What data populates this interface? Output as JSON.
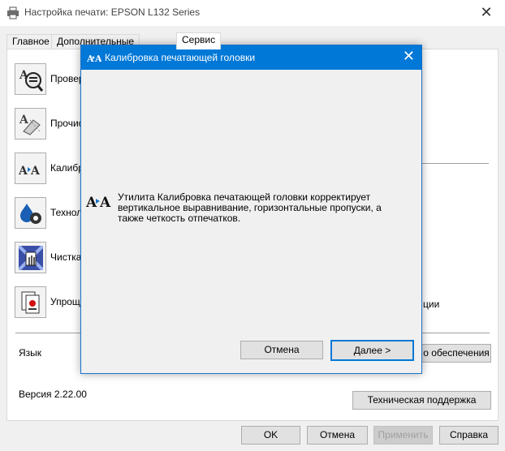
{
  "window": {
    "title": "Настройка печати: EPSON L132 Series",
    "close_glyph": "✕"
  },
  "tabs": [
    {
      "label": "Главное",
      "active": false
    },
    {
      "label": "Дополнительные настройки",
      "active": false
    },
    {
      "label": "Сервис",
      "active": true
    }
  ],
  "tools": [
    {
      "name": "nozzle-check",
      "label": "Провер",
      "icon": "nozzle-check-icon"
    },
    {
      "name": "head-cleaning",
      "label": "Прочис",
      "icon": "head-cleaning-icon"
    },
    {
      "name": "head-alignment",
      "label": "Калибр",
      "icon": "head-alignment-icon"
    },
    {
      "name": "ink-technical",
      "label": "Техноло",
      "icon": "ink-technical-icon"
    },
    {
      "name": "power-cleaning",
      "label": "Чистка",
      "icon": "power-cleaning-icon"
    },
    {
      "name": "simplified",
      "label": "Упроще",
      "icon": "simplified-icon"
    }
  ],
  "right_labels": {
    "row6_tail": "ции"
  },
  "language": {
    "label": "Язык",
    "software_button": "о обеспечения"
  },
  "version": {
    "label": "Версия 2.22.00"
  },
  "support_button": "Техническая поддержка",
  "footer": {
    "ok": "OK",
    "cancel": "Отмена",
    "apply": "Применить",
    "help": "Справка"
  },
  "dialog": {
    "title": "Калибровка печатающей головки",
    "close_glyph": "✕",
    "description": "Утилита Калибровка печатающей головки корректирует вертикальное выравнивание, горизонтальные пропуски, а также четкость отпечатков.",
    "cancel": "Отмена",
    "next": "Далее >"
  },
  "colors": {
    "accent": "#0078d7",
    "background": "#f0f0f0",
    "panel": "#ffffff"
  }
}
